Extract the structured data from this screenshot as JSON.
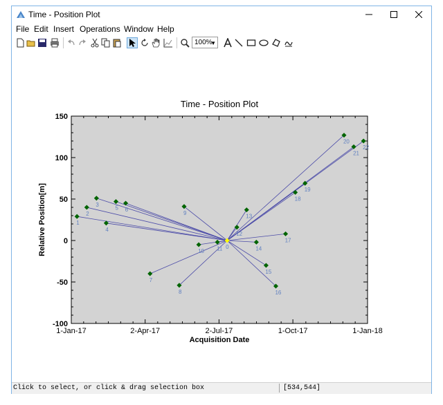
{
  "window": {
    "title": "Time - Position Plot",
    "border_color": "#7fb4e6"
  },
  "menu": [
    "File",
    "Edit",
    "Insert",
    "Operations",
    "Window",
    "Help"
  ],
  "toolbar": {
    "icons": [
      "new-icon",
      "open-icon",
      "save-icon",
      "print-icon",
      "undo-icon",
      "redo-icon",
      "cut-icon",
      "copy-icon",
      "paste-icon",
      "select-arrow-icon",
      "rotate-icon",
      "pan-hand-icon",
      "data-cursor-icon",
      "zoom-icon",
      "text-icon",
      "line-icon",
      "rectangle-icon",
      "ellipse-icon",
      "polygon-icon",
      "freehand-icon"
    ],
    "zoom_value": "100%"
  },
  "status": {
    "message": "Click to select, or click & drag selection box",
    "coords": "[534,544]"
  },
  "chart_data": {
    "type": "scatter",
    "title": "Time - Position Plot",
    "xlabel": "Acquisition Date",
    "ylabel": "Relative Position[m]",
    "x_ticks": [
      "1-Jan-17",
      "2-Apr-17",
      "2-Jul-17",
      "1-Oct-17",
      "1-Jan-18"
    ],
    "x_tick_dates": [
      "2017-01-01",
      "2017-04-02",
      "2017-07-02",
      "2017-10-01",
      "2018-01-01"
    ],
    "xlim": [
      "2017-01-01",
      "2018-01-01"
    ],
    "ylim": [
      -100,
      150
    ],
    "y_ticks": [
      -100,
      -50,
      0,
      50,
      100,
      150
    ],
    "grid": false,
    "background": "#d3d3d3",
    "point_color": "#006400",
    "master_color": "#ffff00",
    "line_color": "#4b4ba8",
    "label_color": "#6080c0",
    "master": {
      "label": "0",
      "date": "2017-07-12",
      "y": 0
    },
    "points": [
      {
        "label": "1",
        "date": "2017-01-08",
        "y": 29
      },
      {
        "label": "2",
        "date": "2017-01-20",
        "y": 40
      },
      {
        "label": "3",
        "date": "2017-02-01",
        "y": 51
      },
      {
        "label": "4",
        "date": "2017-02-13",
        "y": 21
      },
      {
        "label": "5",
        "date": "2017-02-25",
        "y": 47
      },
      {
        "label": "6",
        "date": "2017-03-09",
        "y": 45
      },
      {
        "label": "7",
        "date": "2017-04-08",
        "y": -40
      },
      {
        "label": "8",
        "date": "2017-05-14",
        "y": -54
      },
      {
        "label": "9",
        "date": "2017-05-20",
        "y": 41
      },
      {
        "label": "10",
        "date": "2017-06-07",
        "y": -5
      },
      {
        "label": "11",
        "date": "2017-06-30",
        "y": -2
      },
      {
        "label": "12",
        "date": "2017-07-24",
        "y": 16
      },
      {
        "label": "13",
        "date": "2017-08-05",
        "y": 37
      },
      {
        "label": "14",
        "date": "2017-08-17",
        "y": -2
      },
      {
        "label": "15",
        "date": "2017-08-29",
        "y": -30
      },
      {
        "label": "16",
        "date": "2017-09-10",
        "y": -55
      },
      {
        "label": "17",
        "date": "2017-09-22",
        "y": 8
      },
      {
        "label": "18",
        "date": "2017-10-04",
        "y": 58
      },
      {
        "label": "19",
        "date": "2017-10-16",
        "y": 69
      },
      {
        "label": "20",
        "date": "2017-12-03",
        "y": 127
      },
      {
        "label": "21",
        "date": "2017-12-15",
        "y": 113
      },
      {
        "label": "22",
        "date": "2017-12-27",
        "y": 120
      }
    ]
  }
}
